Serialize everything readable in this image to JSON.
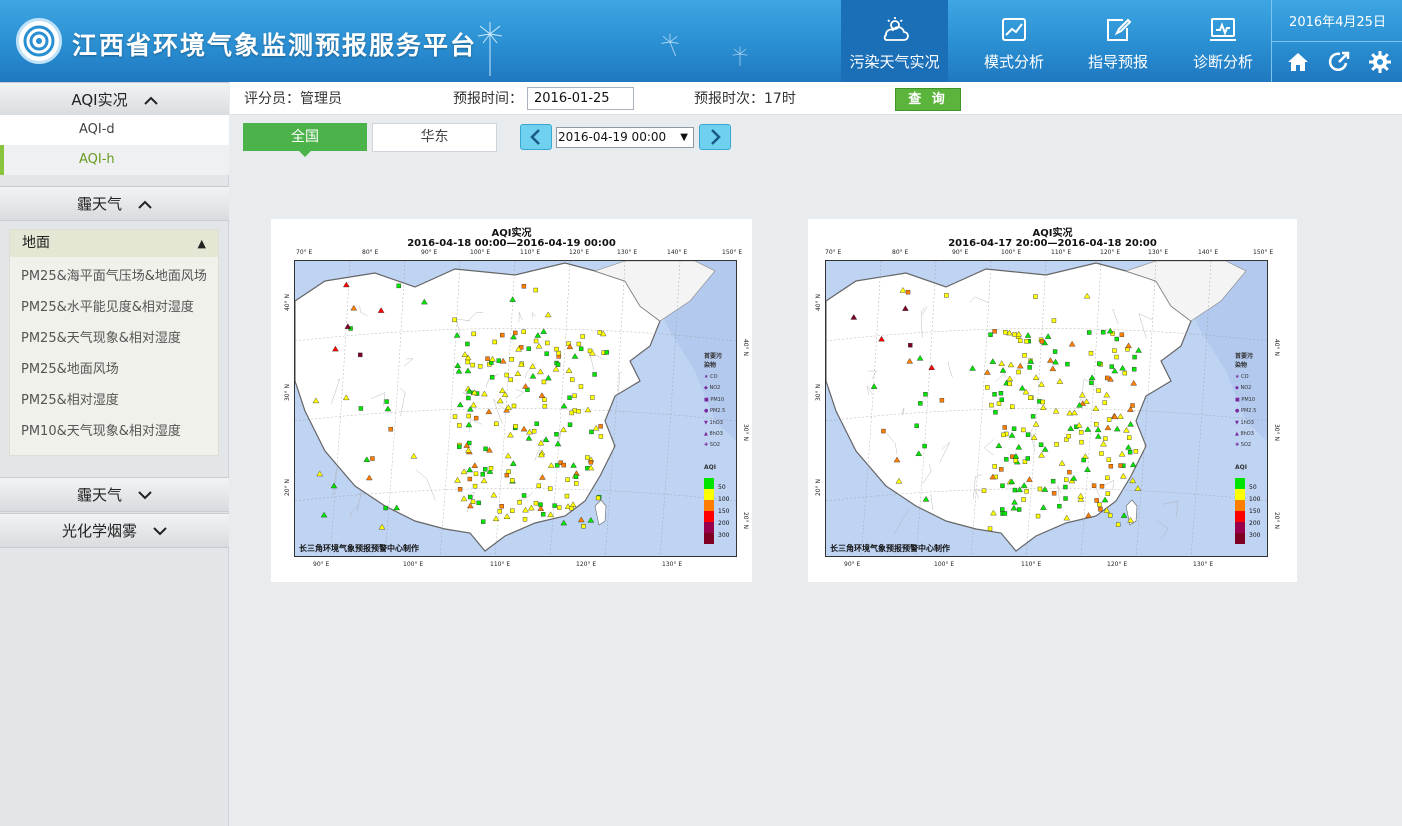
{
  "header": {
    "title": "江西省环境气象监测预报服务平台",
    "date": "2016年4月25日",
    "nav": [
      {
        "label": "污染天气实况",
        "icon": "cloud-sun-icon",
        "active": true
      },
      {
        "label": "模式分析",
        "icon": "line-chart-icon"
      },
      {
        "label": "指导预报",
        "icon": "edit-icon"
      },
      {
        "label": "诊断分析",
        "icon": "monitor-chart-icon"
      }
    ],
    "buttons": [
      "home-icon",
      "share-icon",
      "gear-icon"
    ]
  },
  "sidebar": {
    "sections": [
      {
        "label": "AQI实况",
        "expanded": true,
        "items": [
          {
            "label": "AQI-d"
          },
          {
            "label": "AQI-h",
            "active": true
          }
        ]
      },
      {
        "label": "霾天气",
        "expanded": true,
        "subpanel": {
          "label": "地面",
          "items": [
            "PM25&海平面气压场&地面风场",
            "PM25&水平能见度&相对湿度",
            "PM25&天气现象&相对湿度",
            "PM25&地面风场",
            "PM25&相对湿度",
            "PM10&天气现象&相对湿度"
          ]
        }
      },
      {
        "label": "霾天气",
        "expanded": false
      },
      {
        "label": "光化学烟雾",
        "expanded": false
      }
    ]
  },
  "toolbar": {
    "evaluator_label": "评分员：管理员",
    "forecast_time_label": "预报时间：",
    "forecast_time_value": "2016-01-25",
    "forecast_slot_label": "预报时次：17时",
    "query_label": "查 询"
  },
  "region_tabs": {
    "all": "全国",
    "east": "华东",
    "selected": "全国"
  },
  "time_selector": {
    "value": "2016-04-19 00:00"
  },
  "maps": [
    {
      "title": "AQI实况",
      "subtitle": "2016-04-18 00:00—2016-04-19 00:00",
      "credit": "长三角环境气象预报预警中心制作"
    },
    {
      "title": "AQI实况",
      "subtitle": "2016-04-17 20:00—2016-04-18 20:00",
      "credit": "长三角环境气象预报预警中心制作"
    }
  ],
  "legend": {
    "pollutant_title": "首要污染物",
    "pollutants": [
      "CO",
      "NO2",
      "PM10",
      "PM2.5",
      "1hO3",
      "8hO3",
      "SO2"
    ],
    "aqi_title": "AQI",
    "aqi_levels": [
      "50",
      "100",
      "150",
      "200",
      "300"
    ],
    "aqi_colors": [
      "#00e400",
      "#ffff00",
      "#ff7e00",
      "#ff0000",
      "#99004c",
      "#7e0023"
    ]
  },
  "axes": {
    "top": [
      "70° E",
      "80° E",
      "90° E",
      "100° E",
      "110° E",
      "120° E",
      "130° E",
      "140° E",
      "150° E"
    ],
    "bottom": [
      "90° E",
      "100° E",
      "110° E",
      "120° E",
      "130° E"
    ],
    "left": [
      "40° N",
      "30° N",
      "20° N"
    ],
    "right": [
      "40° N",
      "30° N",
      "20° N"
    ]
  }
}
